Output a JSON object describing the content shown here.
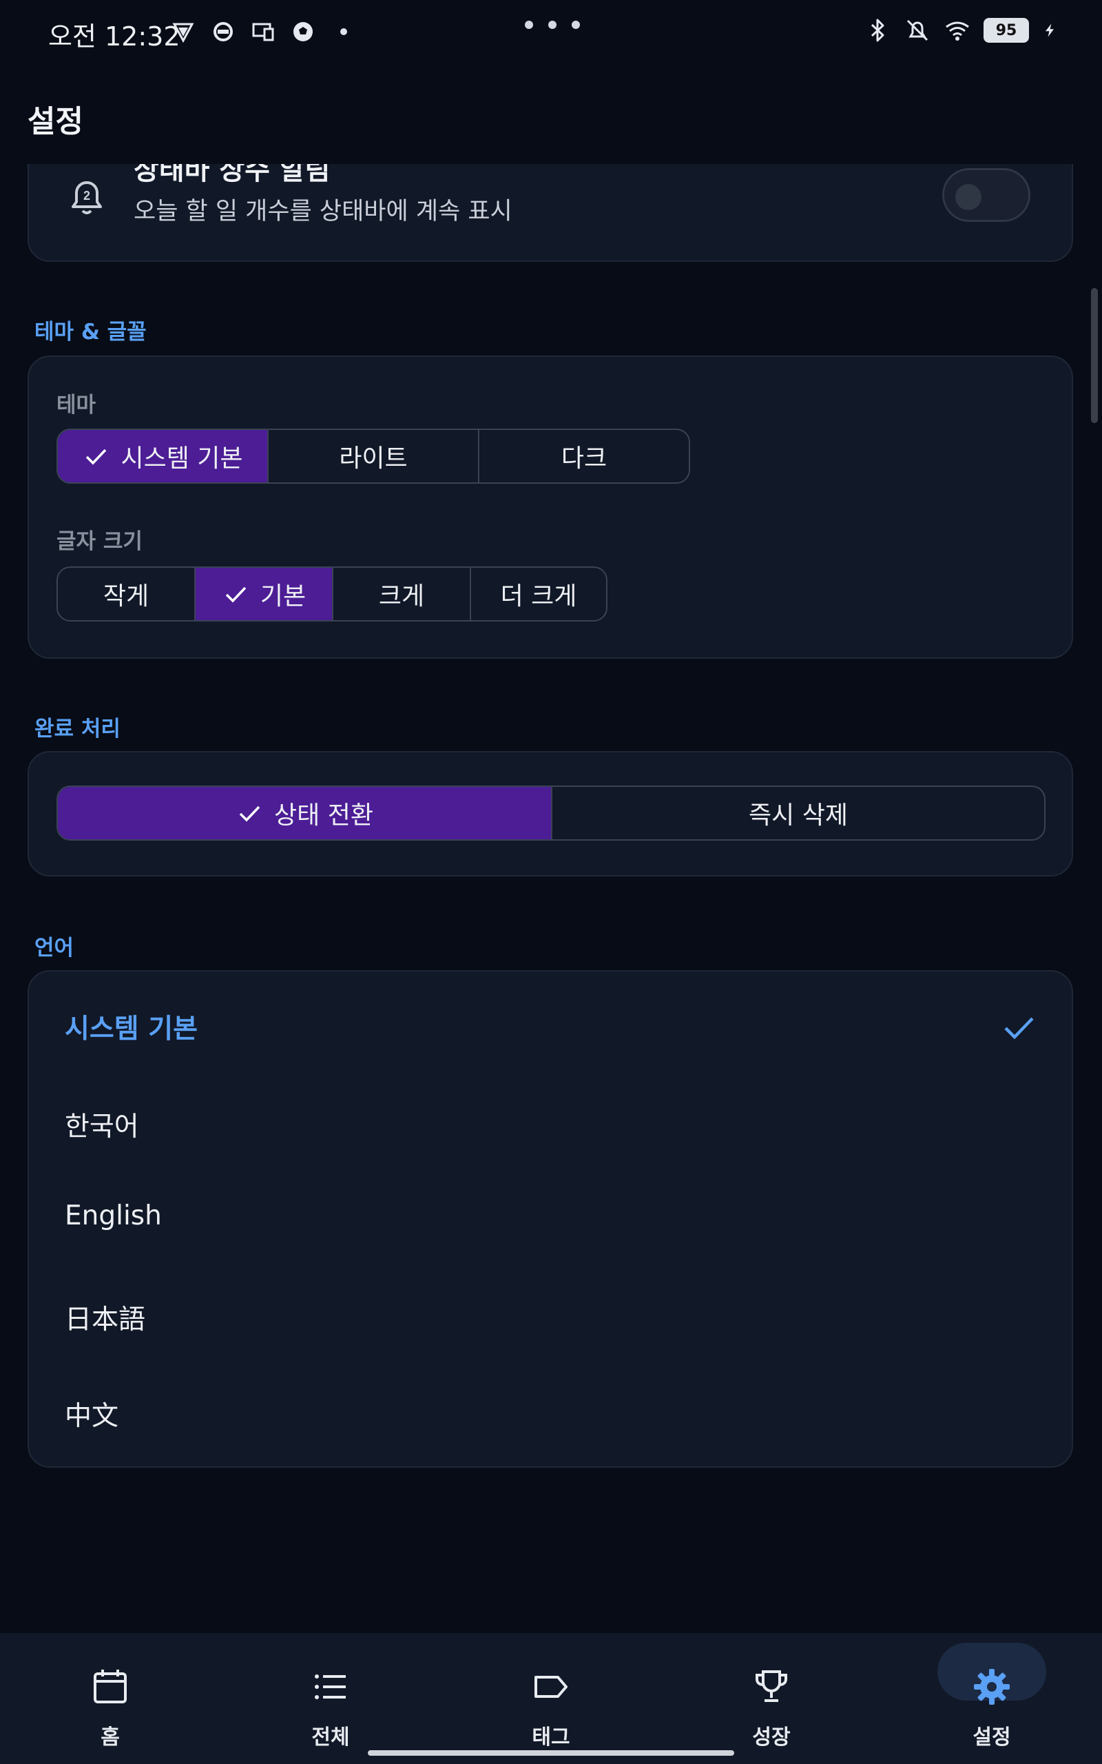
{
  "status_bar": {
    "time": "오전 12:32",
    "battery": "95"
  },
  "app": {
    "title": "설정"
  },
  "notification": {
    "title": "상태바 상수 알림",
    "description": "오늘 할 일 개수를 상태바에 계속 표시",
    "enabled": false
  },
  "theme_section": {
    "header": "테마 & 글꼴",
    "theme_label": "테마",
    "theme_options": [
      "시스템 기본",
      "라이트",
      "다크"
    ],
    "theme_selected": "시스템 기본",
    "font_size_label": "글자 크기",
    "font_size_options": [
      "작게",
      "기본",
      "크게",
      "더 크게"
    ],
    "font_size_selected": "기본"
  },
  "completion_section": {
    "header": "완료 처리",
    "options": [
      "상태 전환",
      "즉시 삭제"
    ],
    "selected": "상태 전환"
  },
  "language_section": {
    "header": "언어",
    "options": [
      "시스템 기본",
      "한국어",
      "English",
      "日本語",
      "中文"
    ],
    "selected": "시스템 기본"
  },
  "bottom_nav": {
    "items": [
      {
        "label": "홈",
        "icon": "calendar-icon"
      },
      {
        "label": "전체",
        "icon": "list-icon"
      },
      {
        "label": "태그",
        "icon": "tag-icon"
      },
      {
        "label": "성장",
        "icon": "trophy-icon"
      },
      {
        "label": "설정",
        "icon": "gear-icon"
      }
    ],
    "active": "설정"
  },
  "colors": {
    "accent": "#5aa0f5",
    "selected_segment": "#4c1d95",
    "background": "#080c16",
    "card": "#111827"
  }
}
